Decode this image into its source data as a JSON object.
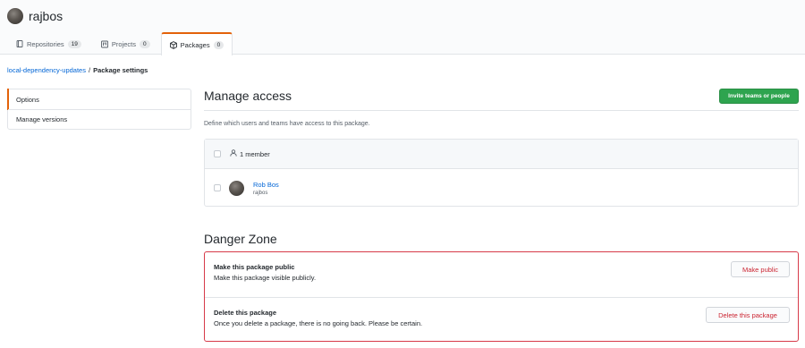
{
  "header": {
    "owner": "rajbos",
    "tabs": [
      {
        "label": "Repositories",
        "count": "19",
        "icon": "repo-icon"
      },
      {
        "label": "Projects",
        "count": "0",
        "icon": "project-icon"
      },
      {
        "label": "Packages",
        "count": "0",
        "icon": "package-icon",
        "selected": true
      }
    ]
  },
  "breadcrumb": {
    "package": "local-dependency-updates",
    "separator": "/",
    "current": "Package settings"
  },
  "sidebar": {
    "items": [
      {
        "label": "Options",
        "active": true
      },
      {
        "label": "Manage versions"
      }
    ]
  },
  "manage_access": {
    "title": "Manage access",
    "invite_button": "Invite teams or people",
    "description": "Define which users and teams have access to this package.",
    "member_count": "1 member",
    "members": [
      {
        "name": "Rob Bos",
        "login": "rajbos"
      }
    ]
  },
  "danger_zone": {
    "title": "Danger Zone",
    "rows": [
      {
        "heading": "Make this package public",
        "text": "Make this package visible publicly.",
        "button": "Make public"
      },
      {
        "heading": "Delete this package",
        "text": "Once you delete a package, there is no going back. Please be certain.",
        "button": "Delete this package"
      }
    ]
  },
  "colors": {
    "accent_tab": "#e36209",
    "primary_button": "#2ea44f",
    "danger": "#d73a49",
    "link": "#0366d6"
  }
}
